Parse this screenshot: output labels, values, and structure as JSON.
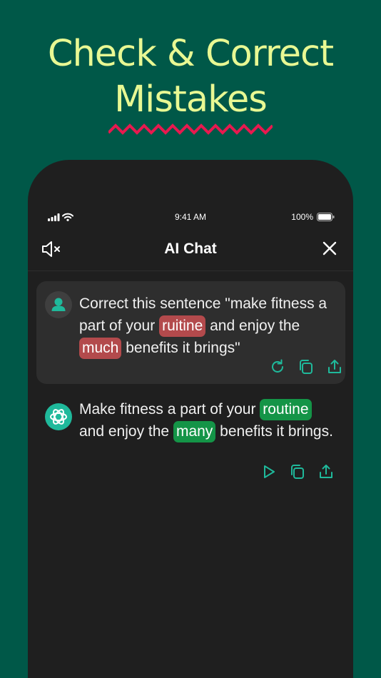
{
  "headline": {
    "line1": "Check & Correct",
    "line2": "Mistakes"
  },
  "colors": {
    "background": "#005848",
    "headline": "#e8f893",
    "zigzag": "#e8194f",
    "phone": "#1f1f1f",
    "accent": "#1fb99b",
    "highlight_wrong": "#b34a4c",
    "highlight_correct": "#149447"
  },
  "status_bar": {
    "time": "9:41 AM",
    "battery": "100%"
  },
  "nav": {
    "title": "AI Chat",
    "left_icon": "speaker-mute-icon",
    "right_icon": "close-icon"
  },
  "messages": {
    "user": {
      "avatar_icon": "user-icon",
      "part1": "Correct this sentence \"make fitness a part of your",
      "wrong1": "ruitine",
      "part2": "and enjoy the",
      "wrong2": "much",
      "part3": "benefits it brings\"",
      "actions": [
        "refresh-icon",
        "copy-icon",
        "share-icon"
      ]
    },
    "ai": {
      "avatar_icon": "openai-logo-icon",
      "part1": "Make fitness a part of your",
      "fix1": "routine",
      "part2": "and enjoy the",
      "fix2": "many",
      "part3": "benefits it brings.",
      "actions": [
        "play-icon",
        "copy-icon",
        "share-icon"
      ]
    }
  }
}
